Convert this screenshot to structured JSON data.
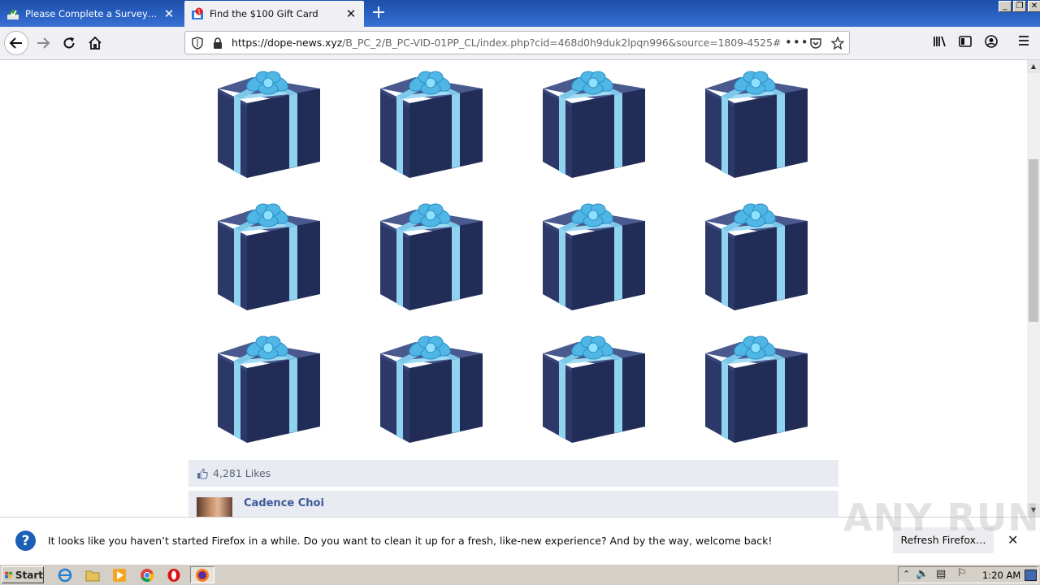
{
  "browser": {
    "tabs": [
      {
        "title": "Please Complete a Survey Below t",
        "active": false
      },
      {
        "title": "Find the $100 Gift Card",
        "active": true
      }
    ],
    "url": {
      "host": "https://dope-news.xyz",
      "rest": "/B_PC_2/B_PC-VID-01PP_CL/index.php?cid=468d0h9duk2lpqn996&source=1809-4525#"
    }
  },
  "page": {
    "gift_grid": {
      "rows": 3,
      "cols": 4,
      "box_color": "#25315c",
      "ribbon_color": "#8fd3f0"
    },
    "likes": "4,281 Likes",
    "commenter": "Cadence Choi"
  },
  "notification": {
    "message": "It looks like you haven’t started Firefox in a while. Do you want to clean it up for a fresh, like-new experience? And by the way, welcome back!",
    "button": "Refresh Firefox…"
  },
  "watermark": "ANY RUN",
  "taskbar": {
    "start": "Start",
    "time": "1:20 AM"
  },
  "colors": {
    "tabstrip": "#2b62c4",
    "link": "#3b5998",
    "likes_bg": "#e9ebf2"
  }
}
